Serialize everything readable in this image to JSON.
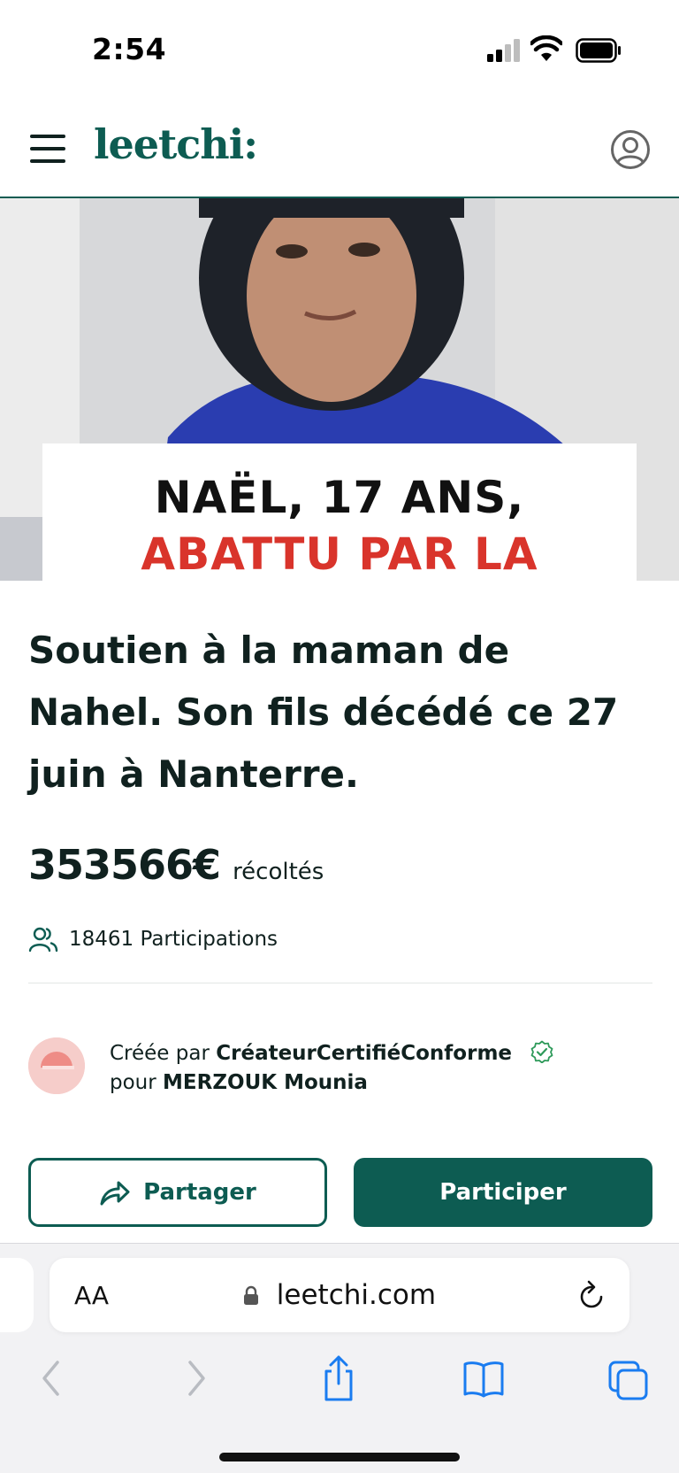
{
  "status_bar": {
    "time": "2:54",
    "icons": [
      "cellular-signal-icon",
      "wifi-icon",
      "battery-icon"
    ]
  },
  "header": {
    "logo": "leetchi:",
    "icons": [
      "hamburger-menu-icon",
      "account-icon"
    ]
  },
  "hero": {
    "line1": "NAËL, 17 ANS,",
    "line2": "ABATTU PAR LA"
  },
  "campaign": {
    "title": "Soutien à la maman de Nahel. Son fils décédé ce 27 juin à Nanterre.",
    "amount": "353566€",
    "amount_label": "récoltés",
    "participations": "18461 Participations"
  },
  "creator": {
    "created_by_prefix": "Créée par",
    "created_by_name": "CréateurCertifiéConforme",
    "for_prefix": "pour",
    "for_name": "MERZOUK Mounia"
  },
  "actions": {
    "share_label": "Partager",
    "participate_label": "Participer"
  },
  "browser": {
    "text_size": "AA",
    "url": "leetchi.com"
  },
  "colors": {
    "brand": "#0d5c52",
    "accent_red": "#d9342b",
    "text": "#10211f",
    "ios_blue": "#1a7cf0"
  }
}
